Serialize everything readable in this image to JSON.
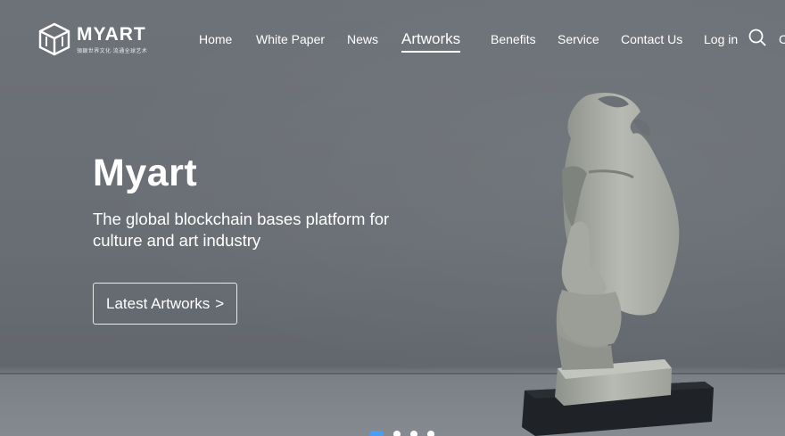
{
  "brand": {
    "name": "MYART",
    "tagline": "領銀世界文化·流通全球艺术",
    "icon": "cube-logo-icon"
  },
  "nav": {
    "items": [
      {
        "label": "Home"
      },
      {
        "label": "White Paper"
      },
      {
        "label": "News"
      },
      {
        "label": "Artworks",
        "active": true
      },
      {
        "label": "Benefits"
      },
      {
        "label": "Service"
      },
      {
        "label": "Contact Us"
      },
      {
        "label": "Log in"
      }
    ],
    "search_icon": "search-icon",
    "edge_glyph": "C"
  },
  "hero": {
    "title": "Myart",
    "subtitle": "The global blockchain bases platform for culture and art industry",
    "cta_label": "Latest Artworks",
    "cta_arrow": ">",
    "image": "thinking-face-sculpture"
  },
  "carousel": {
    "slide_count": 4,
    "active_index": 0,
    "active_color": "#4a9df0"
  },
  "colors": {
    "background": "#6b7076",
    "text": "#ffffff"
  }
}
